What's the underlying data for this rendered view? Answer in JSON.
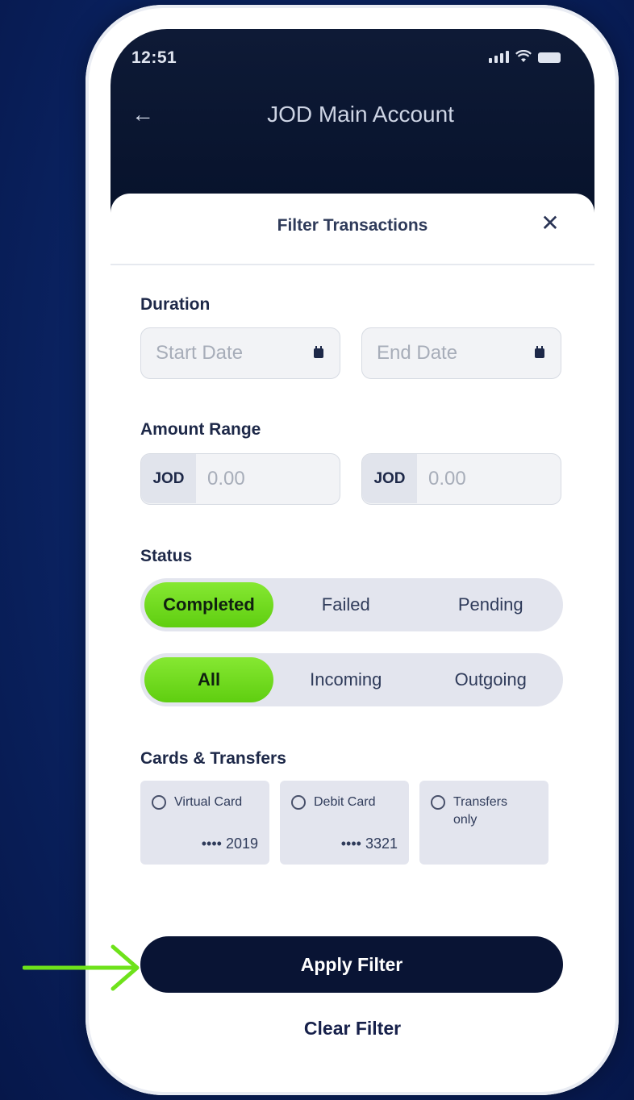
{
  "status_bar": {
    "time": "12:51"
  },
  "nav": {
    "back_icon": "arrow-left-icon",
    "title": "JOD Main Account"
  },
  "sheet": {
    "title": "Filter Transactions",
    "close_icon": "close-icon",
    "duration": {
      "label": "Duration",
      "start_placeholder": "Start Date",
      "end_placeholder": "End Date"
    },
    "amount_range": {
      "label": "Amount Range",
      "min": {
        "currency": "JOD",
        "placeholder": "0.00"
      },
      "max": {
        "currency": "JOD",
        "placeholder": "0.00"
      }
    },
    "status": {
      "label": "Status",
      "state_options": [
        "Completed",
        "Failed",
        "Pending"
      ],
      "state_selected": "Completed",
      "direction_options": [
        "All",
        "Incoming",
        "Outgoing"
      ],
      "direction_selected": "All"
    },
    "cards_transfers": {
      "label": "Cards & Transfers",
      "items": [
        {
          "name": "Virtual Card",
          "number": "•••• 2019"
        },
        {
          "name": "Debit Card",
          "number": "•••• 3321"
        },
        {
          "name": "Transfers only",
          "number": ""
        }
      ]
    },
    "apply_label": "Apply Filter",
    "clear_label": "Clear Filter"
  },
  "colors": {
    "background": "#0b2566",
    "accent_green": "#6ad91a",
    "primary_button": "#091434",
    "header_dark": "#0e1a36"
  }
}
